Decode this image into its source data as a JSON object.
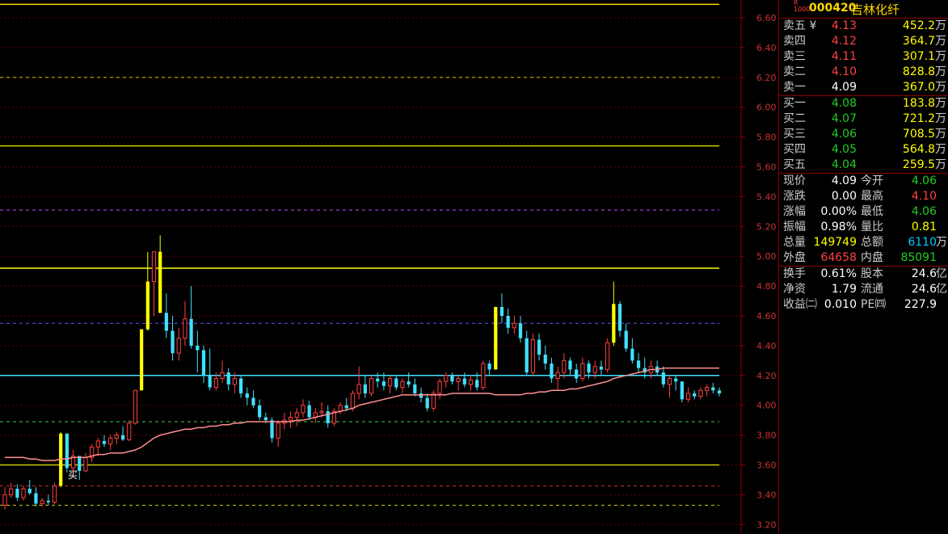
{
  "stock": {
    "badge": "R\n1000",
    "code": "000420",
    "name": "吉林化纤"
  },
  "yaxis": [
    "6.60",
    "6.40",
    "6.20",
    "6.00",
    "5.80",
    "5.60",
    "5.40",
    "5.20",
    "5.00",
    "4.80",
    "4.60",
    "4.40",
    "4.20",
    "4.00",
    "3.80",
    "3.60",
    "3.40",
    "3.20"
  ],
  "sell": [
    {
      "label": "卖五",
      "mark": "¥",
      "price": "4.13",
      "vol": "452.2",
      "unit": "万"
    },
    {
      "label": "卖四",
      "mark": "",
      "price": "4.12",
      "vol": "364.7",
      "unit": "万"
    },
    {
      "label": "卖三",
      "mark": "",
      "price": "4.11",
      "vol": "307.1",
      "unit": "万"
    },
    {
      "label": "卖二",
      "mark": "",
      "price": "4.10",
      "vol": "828.8",
      "unit": "万"
    },
    {
      "label": "卖一",
      "mark": "",
      "price": "4.09",
      "vol": "367.0",
      "unit": "万"
    }
  ],
  "buy": [
    {
      "label": "买一",
      "price": "4.08",
      "vol": "183.8",
      "unit": "万"
    },
    {
      "label": "买二",
      "price": "4.07",
      "vol": "721.2",
      "unit": "万"
    },
    {
      "label": "买三",
      "price": "4.06",
      "vol": "708.5",
      "unit": "万"
    },
    {
      "label": "买四",
      "price": "4.05",
      "vol": "564.8",
      "unit": "万"
    },
    {
      "label": "买五",
      "price": "4.04",
      "vol": "259.5",
      "unit": "万"
    }
  ],
  "quotes1": [
    {
      "l1": "现价",
      "v1": "4.09",
      "c1": "white",
      "l2": "今开",
      "v2": "4.06",
      "c2": "green",
      "u2": ""
    },
    {
      "l1": "涨跌",
      "v1": "0.00",
      "c1": "white",
      "l2": "最高",
      "v2": "4.10",
      "c2": "red",
      "u2": ""
    },
    {
      "l1": "涨幅",
      "v1": "0.00%",
      "c1": "white",
      "l2": "最低",
      "v2": "4.06",
      "c2": "green",
      "u2": ""
    },
    {
      "l1": "振幅",
      "v1": "0.98%",
      "c1": "white",
      "l2": "量比",
      "v2": "0.81",
      "c2": "yellow",
      "u2": ""
    },
    {
      "l1": "总量",
      "v1": "149749",
      "c1": "yellow",
      "l2": "总额",
      "v2": "6110",
      "c2": "cyan",
      "u2": "万"
    },
    {
      "l1": "外盘",
      "v1": "64658",
      "c1": "red",
      "l2": "内盘",
      "v2": "85091",
      "c2": "green",
      "u2": ""
    }
  ],
  "quotes2": [
    {
      "l1": "换手",
      "v1": "0.61%",
      "c1": "white",
      "l2": "股本",
      "v2": "24.6",
      "c2": "white",
      "u2": "亿"
    },
    {
      "l1": "净资",
      "v1": "1.79",
      "c1": "white",
      "l2": "流通",
      "v2": "24.6",
      "c2": "white",
      "u2": "亿"
    },
    {
      "l1": "收益㈡",
      "v1": "0.010",
      "c1": "white",
      "l2": "PE㈣",
      "v2": "227.9",
      "c2": "white",
      "u2": ""
    }
  ],
  "annotation": "买",
  "chart_data": {
    "type": "candlestick",
    "ylim": [
      3.2,
      6.7
    ],
    "hlines": [
      {
        "y": 6.69,
        "color": "#ffd700",
        "style": "solid"
      },
      {
        "y": 6.2,
        "color": "#cccc00",
        "style": "dash"
      },
      {
        "y": 5.74,
        "color": "#cccc00",
        "style": "solid"
      },
      {
        "y": 5.31,
        "color": "#cc44ff",
        "style": "dash"
      },
      {
        "y": 4.92,
        "color": "#ffff00",
        "style": "solid"
      },
      {
        "y": 4.55,
        "color": "#6655ff",
        "style": "dash"
      },
      {
        "y": 4.2,
        "color": "#40e0ff",
        "style": "solid"
      },
      {
        "y": 3.89,
        "color": "#44cc44",
        "style": "dash"
      },
      {
        "y": 3.6,
        "color": "#cccc00",
        "style": "solid"
      },
      {
        "y": 3.46,
        "color": "#cc3333",
        "style": "dash"
      },
      {
        "y": 3.33,
        "color": "#cccc00",
        "style": "dash"
      }
    ],
    "ohlc": [
      [
        3.33,
        3.45,
        3.3,
        3.4
      ],
      [
        3.4,
        3.48,
        3.38,
        3.44
      ],
      [
        3.44,
        3.47,
        3.36,
        3.38
      ],
      [
        3.38,
        3.46,
        3.36,
        3.44
      ],
      [
        3.44,
        3.5,
        3.4,
        3.41
      ],
      [
        3.41,
        3.45,
        3.32,
        3.34
      ],
      [
        3.34,
        3.38,
        3.32,
        3.36
      ],
      [
        3.36,
        3.4,
        3.33,
        3.35
      ],
      [
        3.35,
        3.48,
        3.34,
        3.46
      ],
      [
        3.46,
        3.82,
        3.45,
        3.81
      ],
      [
        3.81,
        3.78,
        3.55,
        3.58
      ],
      [
        3.58,
        3.7,
        3.55,
        3.66
      ],
      [
        3.66,
        3.62,
        3.5,
        3.56
      ],
      [
        3.56,
        3.68,
        3.55,
        3.65
      ],
      [
        3.65,
        3.74,
        3.62,
        3.72
      ],
      [
        3.72,
        3.78,
        3.66,
        3.76
      ],
      [
        3.76,
        3.8,
        3.72,
        3.74
      ],
      [
        3.74,
        3.8,
        3.7,
        3.78
      ],
      [
        3.78,
        3.82,
        3.74,
        3.8
      ],
      [
        3.8,
        3.86,
        3.76,
        3.77
      ],
      [
        3.77,
        3.9,
        3.76,
        3.88
      ],
      [
        3.88,
        4.1,
        3.87,
        4.1
      ],
      [
        4.1,
        4.51,
        4.18,
        4.51
      ],
      [
        4.51,
        5.03,
        4.5,
        4.83
      ],
      [
        4.83,
        5.03,
        4.6,
        5.03
      ],
      [
        5.03,
        5.14,
        4.62,
        4.62
      ],
      [
        4.62,
        4.75,
        4.45,
        4.5
      ],
      [
        4.5,
        4.6,
        4.3,
        4.35
      ],
      [
        4.35,
        4.52,
        4.3,
        4.45
      ],
      [
        4.45,
        4.7,
        4.4,
        4.58
      ],
      [
        4.58,
        4.8,
        4.38,
        4.4
      ],
      [
        4.4,
        4.5,
        4.22,
        4.37
      ],
      [
        4.37,
        4.4,
        4.15,
        4.2
      ],
      [
        4.2,
        4.38,
        4.1,
        4.12
      ],
      [
        4.12,
        4.22,
        4.1,
        4.18
      ],
      [
        4.18,
        4.3,
        4.15,
        4.22
      ],
      [
        4.22,
        4.25,
        4.1,
        4.14
      ],
      [
        4.14,
        4.22,
        4.08,
        4.18
      ],
      [
        4.18,
        4.2,
        4.05,
        4.08
      ],
      [
        4.08,
        4.12,
        4.0,
        4.05
      ],
      [
        4.05,
        4.1,
        3.98,
        4.0
      ],
      [
        4.0,
        4.04,
        3.9,
        3.92
      ],
      [
        3.92,
        3.95,
        3.88,
        3.9
      ],
      [
        3.9,
        3.92,
        3.75,
        3.78
      ],
      [
        3.78,
        3.9,
        3.72,
        3.88
      ],
      [
        3.88,
        3.95,
        3.84,
        3.9
      ],
      [
        3.9,
        3.96,
        3.85,
        3.92
      ],
      [
        3.92,
        3.98,
        3.86,
        3.95
      ],
      [
        3.95,
        4.04,
        3.92,
        4.0
      ],
      [
        4.0,
        4.03,
        3.9,
        3.92
      ],
      [
        3.92,
        3.98,
        3.88,
        3.95
      ],
      [
        3.95,
        4.02,
        3.92,
        3.96
      ],
      [
        3.96,
        4.0,
        3.85,
        3.88
      ],
      [
        3.88,
        3.98,
        3.86,
        3.96
      ],
      [
        3.96,
        4.02,
        3.94,
        4.0
      ],
      [
        4.0,
        4.05,
        3.96,
        3.98
      ],
      [
        3.98,
        4.1,
        3.96,
        4.08
      ],
      [
        4.08,
        4.26,
        4.04,
        4.14
      ],
      [
        4.14,
        4.2,
        4.05,
        4.08
      ],
      [
        4.08,
        4.2,
        4.06,
        4.18
      ],
      [
        4.18,
        4.22,
        4.12,
        4.16
      ],
      [
        4.16,
        4.22,
        4.1,
        4.13
      ],
      [
        4.13,
        4.2,
        4.08,
        4.18
      ],
      [
        4.18,
        4.2,
        4.1,
        4.12
      ],
      [
        4.12,
        4.18,
        4.08,
        4.16
      ],
      [
        4.16,
        4.22,
        4.12,
        4.14
      ],
      [
        4.14,
        4.18,
        4.06,
        4.08
      ],
      [
        4.08,
        4.12,
        4.02,
        4.05
      ],
      [
        4.05,
        4.08,
        3.96,
        3.98
      ],
      [
        3.98,
        4.1,
        3.96,
        4.08
      ],
      [
        4.08,
        4.18,
        4.04,
        4.16
      ],
      [
        4.16,
        4.22,
        4.12,
        4.2
      ],
      [
        4.2,
        4.22,
        4.14,
        4.16
      ],
      [
        4.16,
        4.2,
        4.1,
        4.18
      ],
      [
        4.18,
        4.22,
        4.12,
        4.14
      ],
      [
        4.14,
        4.2,
        4.1,
        4.17
      ],
      [
        4.17,
        4.22,
        4.1,
        4.12
      ],
      [
        4.12,
        4.3,
        4.1,
        4.28
      ],
      [
        4.28,
        4.3,
        4.2,
        4.24
      ],
      [
        4.24,
        4.66,
        4.24,
        4.66
      ],
      [
        4.66,
        4.75,
        4.55,
        4.6
      ],
      [
        4.6,
        4.65,
        4.48,
        4.52
      ],
      [
        4.52,
        4.6,
        4.48,
        4.55
      ],
      [
        4.55,
        4.6,
        4.42,
        4.45
      ],
      [
        4.45,
        4.5,
        4.2,
        4.22
      ],
      [
        4.22,
        4.48,
        4.2,
        4.44
      ],
      [
        4.44,
        4.48,
        4.3,
        4.34
      ],
      [
        4.34,
        4.4,
        4.24,
        4.28
      ],
      [
        4.28,
        4.32,
        4.15,
        4.18
      ],
      [
        4.18,
        4.26,
        4.1,
        4.22
      ],
      [
        4.22,
        4.35,
        4.18,
        4.3
      ],
      [
        4.3,
        4.32,
        4.2,
        4.24
      ],
      [
        4.24,
        4.28,
        4.15,
        4.18
      ],
      [
        4.18,
        4.32,
        4.16,
        4.28
      ],
      [
        4.28,
        4.3,
        4.18,
        4.22
      ],
      [
        4.22,
        4.3,
        4.18,
        4.26
      ],
      [
        4.26,
        4.3,
        4.2,
        4.24
      ],
      [
        4.24,
        4.45,
        4.22,
        4.42
      ],
      [
        4.42,
        4.83,
        4.4,
        4.68
      ],
      [
        4.68,
        4.7,
        4.46,
        4.5
      ],
      [
        4.5,
        4.55,
        4.36,
        4.38
      ],
      [
        4.38,
        4.45,
        4.28,
        4.3
      ],
      [
        4.3,
        4.35,
        4.22,
        4.25
      ],
      [
        4.25,
        4.32,
        4.18,
        4.22
      ],
      [
        4.22,
        4.3,
        4.18,
        4.26
      ],
      [
        4.26,
        4.3,
        4.2,
        4.22
      ],
      [
        4.22,
        4.26,
        4.12,
        4.14
      ],
      [
        4.14,
        4.2,
        4.05,
        4.18
      ],
      [
        4.18,
        4.2,
        4.1,
        4.16
      ],
      [
        4.16,
        4.12,
        4.02,
        4.04
      ],
      [
        4.04,
        4.12,
        4.02,
        4.08
      ],
      [
        4.08,
        4.1,
        4.04,
        4.06
      ],
      [
        4.06,
        4.12,
        4.04,
        4.1
      ],
      [
        4.1,
        4.14,
        4.06,
        4.12
      ],
      [
        4.12,
        4.15,
        4.08,
        4.1
      ],
      [
        4.1,
        4.12,
        4.06,
        4.08
      ]
    ],
    "ma": [
      3.65,
      3.65,
      3.65,
      3.65,
      3.64,
      3.64,
      3.63,
      3.63,
      3.63,
      3.64,
      3.64,
      3.65,
      3.65,
      3.65,
      3.66,
      3.67,
      3.67,
      3.68,
      3.68,
      3.68,
      3.69,
      3.7,
      3.72,
      3.75,
      3.78,
      3.8,
      3.81,
      3.82,
      3.83,
      3.84,
      3.84,
      3.85,
      3.85,
      3.86,
      3.86,
      3.87,
      3.87,
      3.88,
      3.88,
      3.89,
      3.89,
      3.89,
      3.89,
      3.89,
      3.89,
      3.89,
      3.89,
      3.9,
      3.9,
      3.91,
      3.92,
      3.93,
      3.94,
      3.95,
      3.96,
      3.97,
      3.98,
      4.0,
      4.01,
      4.02,
      4.03,
      4.04,
      4.05,
      4.06,
      4.07,
      4.07,
      4.07,
      4.07,
      4.07,
      4.07,
      4.07,
      4.07,
      4.08,
      4.08,
      4.08,
      4.08,
      4.08,
      4.08,
      4.08,
      4.07,
      4.07,
      4.07,
      4.07,
      4.07,
      4.08,
      4.08,
      4.09,
      4.09,
      4.1,
      4.1,
      4.1,
      4.11,
      4.11,
      4.12,
      4.13,
      4.14,
      4.15,
      4.16,
      4.18,
      4.19,
      4.2,
      4.21,
      4.22,
      4.23,
      4.24,
      4.24,
      4.25,
      4.25,
      4.25,
      4.25,
      4.25,
      4.25,
      4.25,
      4.25,
      4.25,
      4.25,
      4.25
    ]
  }
}
